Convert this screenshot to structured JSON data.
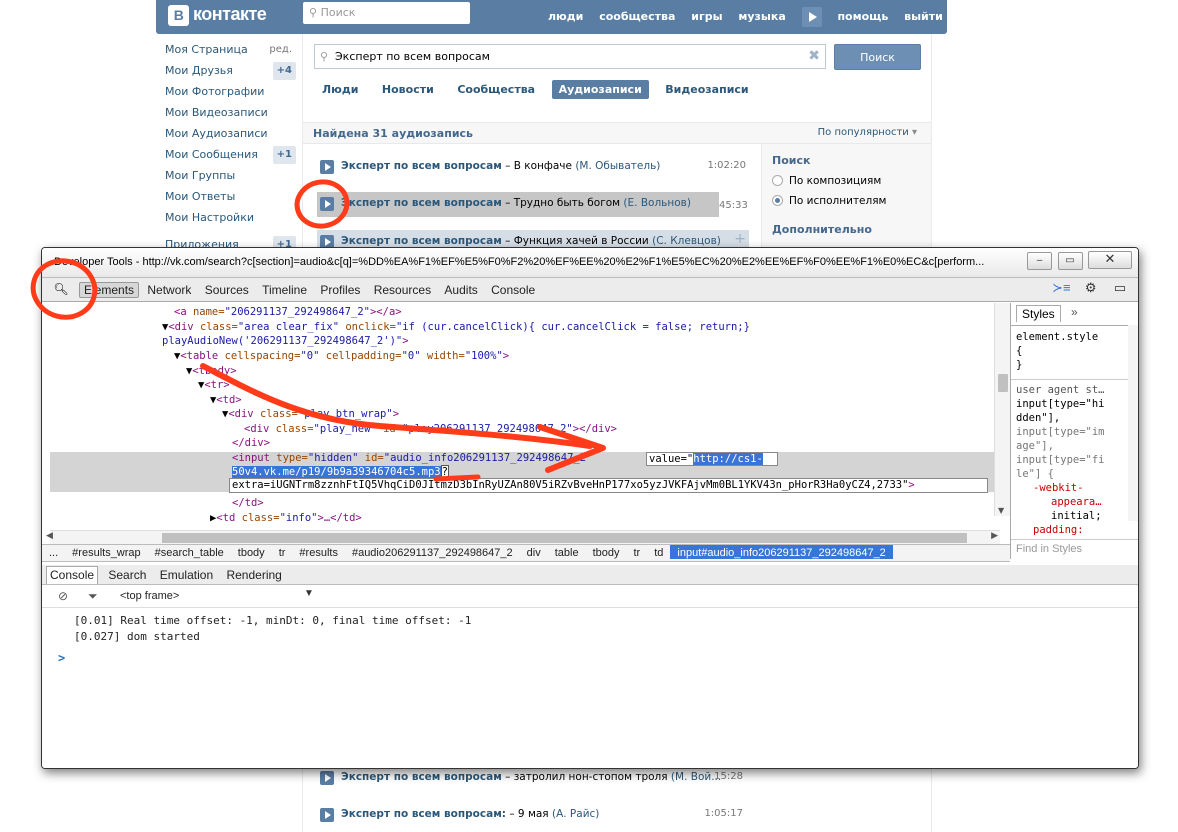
{
  "vk": {
    "logo_letter": "В",
    "logo_text": "контакте",
    "top_search_placeholder": "Поиск",
    "top_links": [
      "люди",
      "сообщества",
      "игры",
      "музыка",
      "помощь",
      "выйти"
    ],
    "left_menu": [
      {
        "label": "Моя Страница",
        "extra": "ред."
      },
      {
        "label": "Мои Друзья",
        "badge": "+4"
      },
      {
        "label": "Мои Фотографии"
      },
      {
        "label": "Мои Видеозаписи"
      },
      {
        "label": "Мои Аудиозаписи"
      },
      {
        "label": "Мои Сообщения",
        "badge": "+1"
      },
      {
        "label": "Мои Группы"
      },
      {
        "label": "Мои Ответы"
      },
      {
        "label": "Мои Настройки"
      },
      {
        "label": "Приложения",
        "badge": "+1"
      }
    ],
    "search_query": "Эксперт по всем вопросам",
    "search_button": "Поиск",
    "tabs": [
      "Люди",
      "Новости",
      "Сообщества",
      "Аудиозаписи",
      "Видеозаписи"
    ],
    "active_tab": "Аудиозаписи",
    "results_count": "Найдена 31 аудиозапись",
    "sort_label": "По популярности",
    "audio": [
      {
        "title": "Эксперт по всем вопросам",
        "sep": " – ",
        "track": "В конфаче",
        "artist": "(М. Обыватель)",
        "dur": "1:02:20"
      },
      {
        "title": "Эксперт по всем вопросам",
        "sep": " – ",
        "track": "Трудно быть богом",
        "artist": "(Е. Вольнов)",
        "dur": "45:33"
      },
      {
        "title": "Эксперт по всем вопросам",
        "sep": " – ",
        "track": "Функция хачей в России",
        "artist": "(С. Клевцов)",
        "dur": ""
      }
    ],
    "audio_bottom": [
      {
        "title": "Эксперт по всем вопросам",
        "sep": " – ",
        "track": "затролил нон-стопом троля",
        "artist": "(М. Вой...",
        "dur": "15:28"
      },
      {
        "title": "Эксперт по всем вопросам:",
        "sep": " – ",
        "track": "9 мая",
        "artist": "(А. Райс)",
        "dur": "1:05:17"
      }
    ],
    "side": {
      "heading": "Поиск",
      "options": [
        "По композициям",
        "По исполнителям"
      ],
      "selected": "По исполнителям",
      "heading2": "Дополнительно"
    }
  },
  "devtools": {
    "title": "Developer Tools - http://vk.com/search?c[section]=audio&c[q]=%DD%EA%F1%EF%E5%F0%F2%20%EF%EE%20%E2%F1%E5%EC%20%E2%EE%EF%F0%EE%F1%E0%EC&c[perform...",
    "win_buttons": [
      "‒",
      "▭",
      "✕"
    ],
    "tabs": [
      "Elements",
      "Network",
      "Sources",
      "Timeline",
      "Profiles",
      "Resources",
      "Audits",
      "Console"
    ],
    "active_tab": "Elements",
    "code": {
      "l1_tag": "<a ",
      "l1_attr": "name=",
      "l1_val": "\"206291137_292498647_2\"",
      "l1_end": "></a>",
      "l2_tag": "<div ",
      "l2_a1": "class=",
      "l2_v1": "\"area clear_fix\"",
      "l2_a2": " onclick=",
      "l2_v2": "\"if (cur.cancelClick){ cur.cancelClick = false; return;}",
      "l3_v": "playAudioNew('206291137_292498647_2')\"",
      "l3_end": ">",
      "l4_tag": "<table ",
      "l4_a1": "cellspacing=",
      "l4_v1": "\"0\"",
      "l4_a2": " cellpadding=",
      "l4_v2": "\"0\"",
      "l4_a3": " width=",
      "l4_v3": "\"100%\"",
      "l4_end": ">",
      "l5": "<tbody>",
      "l6": "<tr>",
      "l7": "<td>",
      "l8_tag": "<div ",
      "l8_attr": "class=",
      "l8_val": "\"play_btn_wrap\"",
      "l8_end": ">",
      "l9_tag": "<div ",
      "l9_a1": "class=",
      "l9_v1": "\"play_new\"",
      "l9_a2": " id=",
      "l9_v2": "\"play206291137_292498647_2\"",
      "l9_end": "></div>",
      "l10": "</div>",
      "l11_tag": "<input ",
      "l11_a1": "type=",
      "l11_v1": "\"hidden\"",
      "l11_a2": " id=",
      "l11_v2": "\"audio_info206291137_292498647_2\"",
      "edit_prefix": "value=\"",
      "edit_url_1": "http://cs1-",
      "l12_url": "50v4.vk.me/p19/9b9a39346704c5.mp3",
      "l12_q": "?",
      "l13": "extra=iUGNTrm8zznhFtIQ5VhqCiD0JItmzD3bInRyUZAn80V5iRZvBveHnP177xo5yzJVKFAjvMm0BL1YKV43n_pHorR3Ha0yCZ4,2733\"",
      "l13_end": ">",
      "l14": "</td>",
      "l15_tag": "<td ",
      "l15_a": "class=",
      "l15_v": "\"info\"",
      "l15_end": ">…</td>"
    },
    "styles_tab": "Styles",
    "styles_more": "»",
    "styles": {
      "element_style": "element.style",
      "brace_open": "{",
      "brace_close": "}",
      "ua": "user agent st…",
      "s1": "input[type=\"hi",
      "s2": "dden\"],",
      "s3": "input[type=\"im",
      "s4": "age\"],",
      "s5": "input[type=\"fi",
      "s6": "le\"] {",
      "s7": "-webkit-",
      "s8": "appeara…",
      "s9": "initial;",
      "s10": "padding:"
    },
    "find_in_styles": "Find in Styles",
    "crumbs": [
      "...",
      "#results_wrap",
      "#search_table",
      "tbody",
      "tr",
      "#results",
      "#audio206291137_292498647_2",
      "div",
      "table",
      "tbody",
      "tr",
      "td",
      "input#audio_info206291137_292498647_2"
    ],
    "console_tabs": [
      "Console",
      "Search",
      "Emulation",
      "Rendering"
    ],
    "frame": "<top frame>",
    "logs": [
      "[0.01]  Real time offset: -1, minDt: 0, final time offset: -1",
      "[0.027]  dom started"
    ],
    "prompt": ">"
  },
  "colors": {
    "vk_blue": "#597da3",
    "annotation": "#ff3b1a",
    "selection": "#3875d7"
  }
}
